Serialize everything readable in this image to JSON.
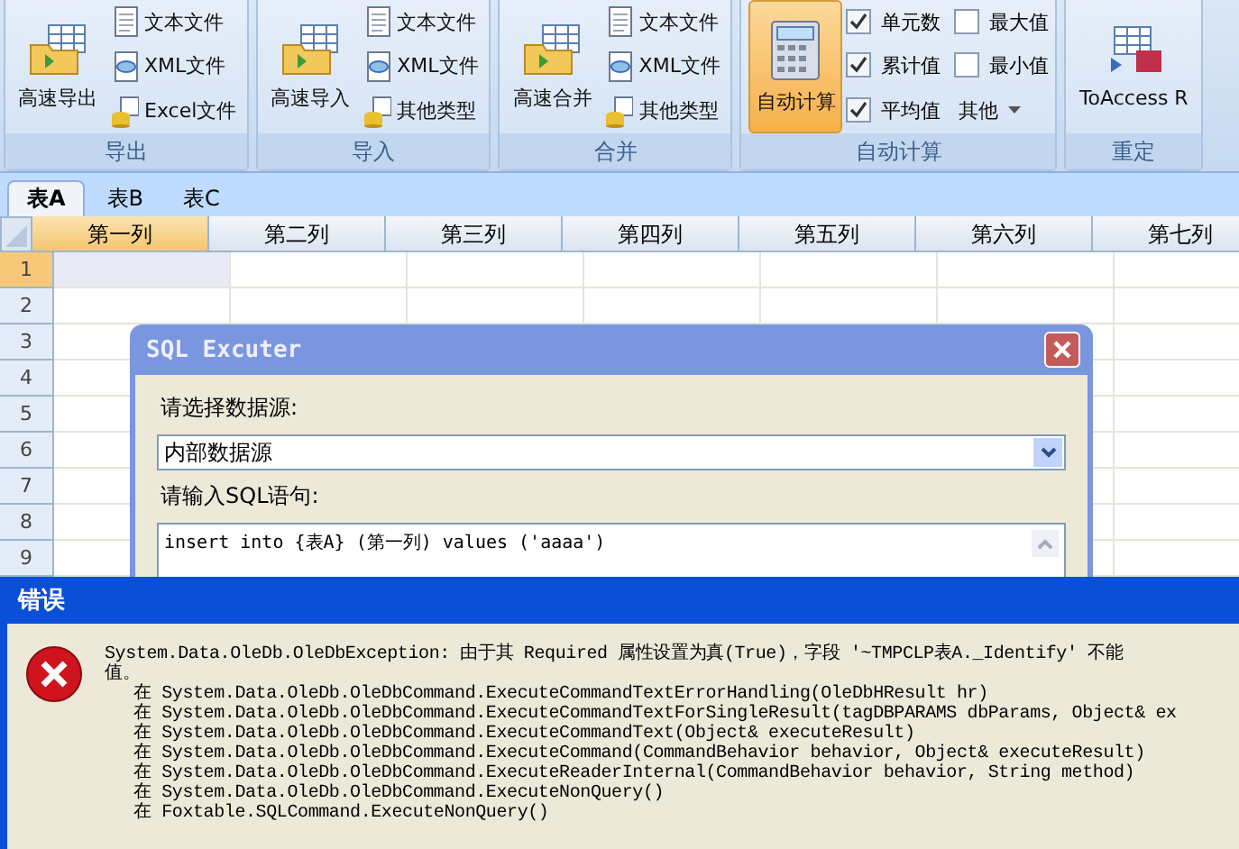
{
  "ribbon": {
    "groups": [
      {
        "label": "导出",
        "large": {
          "label": "高速导出",
          "selected": false
        },
        "items": [
          {
            "kind": "button",
            "label": "文本文件"
          },
          {
            "kind": "button",
            "label": "XML文件"
          },
          {
            "kind": "button",
            "label": "Excel文件"
          }
        ]
      },
      {
        "label": "导入",
        "large": {
          "label": "高速导入",
          "selected": false
        },
        "items": [
          {
            "kind": "button",
            "label": "文本文件"
          },
          {
            "kind": "button",
            "label": "XML文件"
          },
          {
            "kind": "button",
            "label": "其他类型"
          }
        ]
      },
      {
        "label": "合并",
        "large": {
          "label": "高速合并",
          "selected": false
        },
        "items": [
          {
            "kind": "button",
            "label": "文本文件"
          },
          {
            "kind": "button",
            "label": "XML文件"
          },
          {
            "kind": "button",
            "label": "其他类型"
          }
        ]
      },
      {
        "label": "自动计算",
        "large": {
          "label": "自动计算",
          "selected": true
        },
        "items": [
          {
            "kind": "checkbox",
            "label": "单元数",
            "checked": true
          },
          {
            "kind": "checkbox",
            "label": "最大值",
            "checked": false
          },
          {
            "kind": "checkbox",
            "label": "累计值",
            "checked": true
          },
          {
            "kind": "checkbox",
            "label": "最小值",
            "checked": false
          },
          {
            "kind": "checkbox",
            "label": "平均值",
            "checked": true
          },
          {
            "kind": "dropdown",
            "label": "其他"
          }
        ]
      },
      {
        "label": "重定",
        "large": {
          "label": "ToAccess R",
          "selected": false
        }
      }
    ]
  },
  "sheet_tabs": [
    {
      "label": "表A",
      "selected": true
    },
    {
      "label": "表B",
      "selected": false
    },
    {
      "label": "表C",
      "selected": false
    }
  ],
  "grid": {
    "columns": [
      {
        "label": "第一列",
        "selected": true
      },
      {
        "label": "第二列",
        "selected": false
      },
      {
        "label": "第三列",
        "selected": false
      },
      {
        "label": "第四列",
        "selected": false
      },
      {
        "label": "第五列",
        "selected": false
      },
      {
        "label": "第六列",
        "selected": false
      },
      {
        "label": "第七列",
        "selected": false
      }
    ],
    "rows": [
      {
        "label": "1",
        "selected": true
      },
      {
        "label": "2",
        "selected": false
      },
      {
        "label": "3",
        "selected": false
      },
      {
        "label": "4",
        "selected": false
      },
      {
        "label": "5",
        "selected": false
      },
      {
        "label": "6",
        "selected": false
      },
      {
        "label": "7",
        "selected": false
      },
      {
        "label": "8",
        "selected": false
      },
      {
        "label": "9",
        "selected": false
      }
    ]
  },
  "sql_dialog": {
    "title": "SQL Excuter",
    "source_label": "请选择数据源:",
    "source_value": "内部数据源",
    "sql_label": "请输入SQL语句:",
    "sql_value": "insert into {表A} (第一列) values ('aaaa')"
  },
  "error_dialog": {
    "title": "错误",
    "message": "System.Data.OleDb.OleDbException: 由于其 Required 属性设置为真(True)，字段 '~TMPCLP表A._Identify' 不能",
    "message_cont": "值。",
    "stack": [
      "在 System.Data.OleDb.OleDbCommand.ExecuteCommandTextErrorHandling(OleDbHResult hr)",
      "在 System.Data.OleDb.OleDbCommand.ExecuteCommandTextForSingleResult(tagDBPARAMS dbParams, Object& ex",
      "在 System.Data.OleDb.OleDbCommand.ExecuteCommandText(Object& executeResult)",
      "在 System.Data.OleDb.OleDbCommand.ExecuteCommand(CommandBehavior behavior, Object& executeResult)",
      "在 System.Data.OleDb.OleDbCommand.ExecuteReaderInternal(CommandBehavior behavior, String method)",
      "在 System.Data.OleDb.OleDbCommand.ExecuteNonQuery()",
      "在 Foxtable.SQLCommand.ExecuteNonQuery()"
    ]
  }
}
